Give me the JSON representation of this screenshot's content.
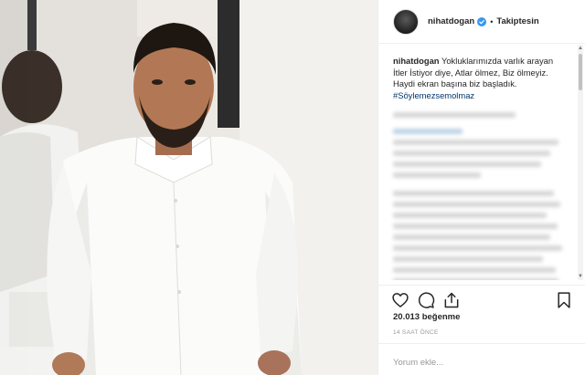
{
  "post": {
    "username": "nihatdogan",
    "follow_label": "Takiptesin",
    "separator": "•",
    "caption_user": "nihatdogan",
    "caption_text": " Yokluklarımızda varlık arayan İtler İstiyor diye, Atlar ölmez, Biz ölmeyiz. Haydi ekran başına biz başladık. ",
    "hashtag": "#Söylemezsemolmaz",
    "likes": "20.013 beğenme",
    "time_ago": "14 SAAT ÖNCE",
    "comment_placeholder": "Yorum ekle..."
  },
  "icons": {
    "avatar": "profile-avatar",
    "verified": "verified-badge-icon",
    "like": "heart-icon",
    "comment": "comment-bubble-icon",
    "share": "share-icon",
    "save": "bookmark-icon"
  },
  "colors": {
    "verified_blue": "#3897f0",
    "hashtag": "#003569",
    "text": "#262626",
    "muted": "#999999",
    "border": "#efefef"
  }
}
